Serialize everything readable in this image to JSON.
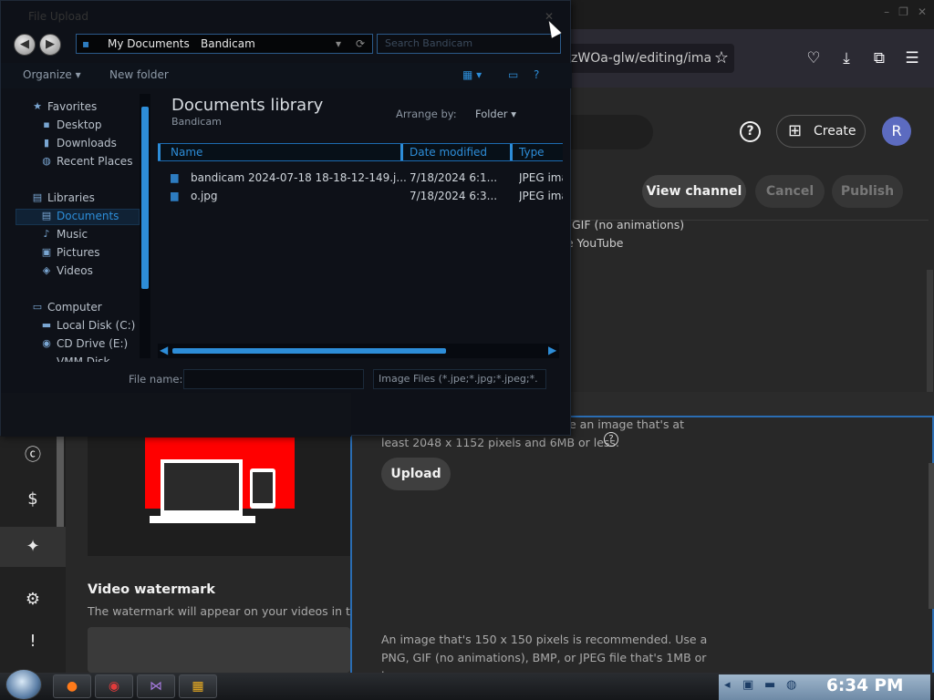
{
  "browser": {
    "url_fragment": "zWOa-glw/editing/ima",
    "window_controls": [
      "–",
      "❐",
      "✕"
    ]
  },
  "yt": {
    "create_label": "Create",
    "avatar_letter": "R",
    "view_channel": "View channel",
    "cancel": "Cancel",
    "publish": "Publish",
    "gif_line": "GIF (no animations)",
    "youtube_line": "e YouTube",
    "wm_title": "Video watermark",
    "wm_desc": "The watermark will appear on your videos in the right-hand corner of the video player",
    "upload": "Upload",
    "cap_line1": "e an image that's at",
    "cap_line2": "least 2048 x 1152 pixels and 6MB or less.",
    "rec_line1": "An image that's 150 x 150 pixels is recommended. Use a",
    "rec_line2": "PNG, GIF (no animations), BMP, or JPEG file that's 1MB or",
    "rec_line3": "less."
  },
  "capture": {
    "size": "1021x410"
  },
  "dialog": {
    "title": "File Upload",
    "address": [
      "My Documents",
      "Bandicam"
    ],
    "search_placeholder": "Search Bandicam",
    "organize": "Organize",
    "new_folder": "New folder",
    "nav": {
      "favorites": "Favorites",
      "desktop": "Desktop",
      "downloads": "Downloads",
      "recent": "Recent Places",
      "libraries": "Libraries",
      "documents": "Documents",
      "music": "Music",
      "pictures": "Pictures",
      "videos": "Videos",
      "computer": "Computer",
      "local_disk": "Local Disk (C:)",
      "cd_drive": "CD Drive (E:)",
      "more": "VMM Disk..."
    },
    "library_title": "Documents library",
    "library_sub": "Bandicam",
    "arrange_by": "Arrange by:",
    "arrange_value": "Folder",
    "columns": {
      "name": "Name",
      "date": "Date modified",
      "type": "Type"
    },
    "files": [
      {
        "name": "bandicam 2024-07-18 18-18-12-149.j...",
        "date": "7/18/2024 6:1...",
        "type": "JPEG ima"
      },
      {
        "name": "o.jpg",
        "date": "7/18/2024 6:3...",
        "type": "JPEG ima"
      }
    ],
    "file_name_label": "File name:",
    "file_name_value": "",
    "filter": "Image Files (*.jpe;*.jpg;*.jpeg;*."
  },
  "taskbar": {
    "clock": "6:34 PM"
  }
}
